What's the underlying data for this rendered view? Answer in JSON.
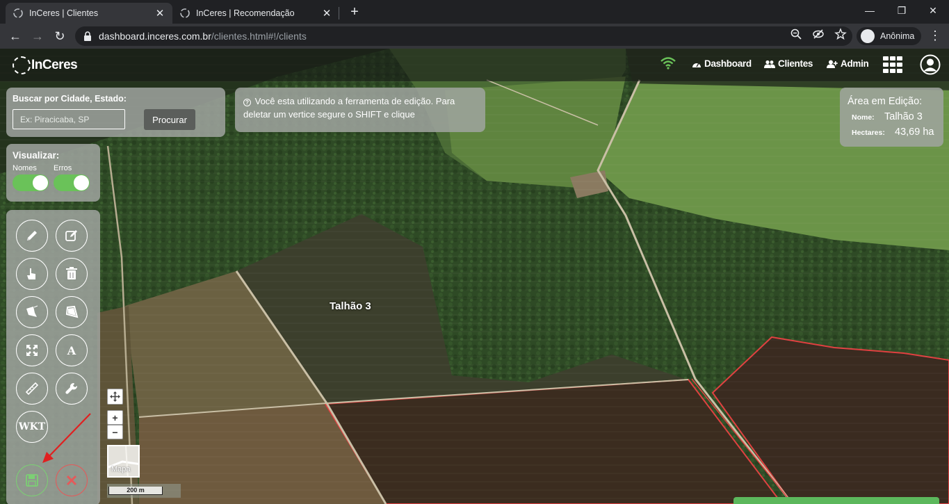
{
  "browser": {
    "tabs": [
      {
        "title": "InCeres | Clientes",
        "active": true
      },
      {
        "title": "InCeres | Recomendação",
        "active": false
      }
    ],
    "new_tab": "+",
    "url_host": "dashboard.inceres.com.br",
    "url_path": "/clientes.html#!/clients",
    "profile_label": "Anônima"
  },
  "app": {
    "logo": "InCeres",
    "nav": {
      "dashboard": "Dashboard",
      "clients": "Clientes",
      "admin": "Admin"
    }
  },
  "search": {
    "label": "Buscar por Cidade, Estado:",
    "placeholder": "Ex: Piracicaba, SP",
    "button": "Procurar"
  },
  "info": {
    "message": "Você esta utilizando a ferramenta de edição. Para deletar um vertice segure o SHIFT e clique"
  },
  "edit_area": {
    "title": "Área em Edição:",
    "name_key": "Nome:",
    "name_value": "Talhão 3",
    "hectares_key": "Hectares:",
    "hectares_value": "43,69 ha"
  },
  "view": {
    "title": "Visualizar:",
    "toggles": [
      {
        "label": "Nomes",
        "on": true
      },
      {
        "label": "Erros",
        "on": true
      }
    ]
  },
  "tools": {
    "text_tool": "A",
    "wkt_tool": "WKT"
  },
  "map": {
    "field_label": "Talhão 3",
    "zoom_in": "+",
    "zoom_out": "−",
    "basemap_label": "Mapa",
    "scale_label": "200 m"
  },
  "colors": {
    "accent_green": "#6ac259",
    "save_green": "#7ccf74",
    "cancel_red": "#e45a5a",
    "field_border_red": "#e04040"
  }
}
